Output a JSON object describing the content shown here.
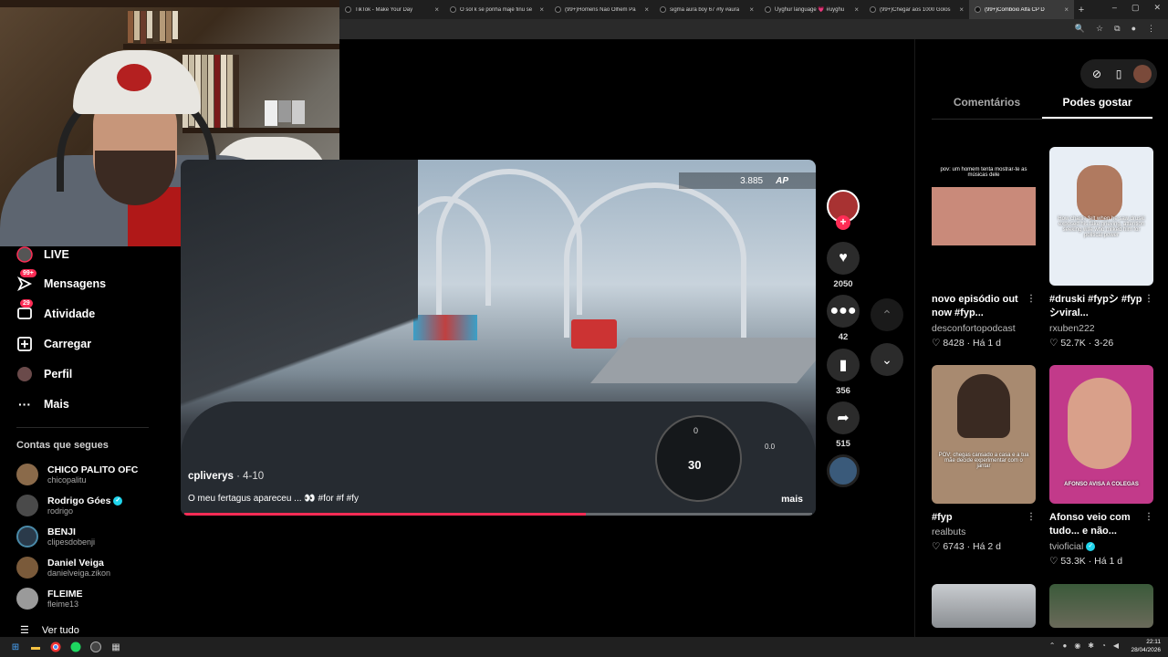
{
  "browser": {
    "tabs": [
      {
        "title": "TikTok - Make Your Day",
        "active": false
      },
      {
        "title": "O sol k se ponha majé finu se",
        "active": false
      },
      {
        "title": "(99+)Homens Não Olhem Pa",
        "active": false
      },
      {
        "title": "sigma aura boy 67 #fy #aura",
        "active": false
      },
      {
        "title": "Uyghur language 💗 #uyghu",
        "active": false
      },
      {
        "title": "(99+)Chegar aos 1000 Golos",
        "active": false
      },
      {
        "title": "(99+)Comboio Alfa CP D",
        "active": true
      }
    ],
    "new_tab": "+",
    "window_controls": [
      "–",
      "▢",
      "✕"
    ]
  },
  "sidebar": {
    "items": [
      {
        "label": "LIVE",
        "icon": "live-icon",
        "badge": ""
      },
      {
        "label": "Mensagens",
        "icon": "messages-icon",
        "badge": "99+"
      },
      {
        "label": "Atividade",
        "icon": "activity-icon",
        "badge": "29"
      },
      {
        "label": "Carregar",
        "icon": "upload-icon",
        "badge": ""
      },
      {
        "label": "Perfil",
        "icon": "profile-icon",
        "badge": ""
      },
      {
        "label": "Mais",
        "icon": "more-icon",
        "badge": ""
      }
    ],
    "following_title": "Contas que segues",
    "following": [
      {
        "name": "CHICO PALITO OFC",
        "handle": "chicopalitu",
        "verified": false
      },
      {
        "name": "Rodrigo Góes",
        "handle": "rodrigo",
        "verified": true
      },
      {
        "name": "BENJI",
        "handle": "clipesdobenji",
        "verified": false
      },
      {
        "name": "Daniel Veiga",
        "handle": "danielveiga.zikon",
        "verified": false
      },
      {
        "name": "FLEIME",
        "handle": "fleime13",
        "verified": false
      }
    ],
    "see_all": "Ver tudo"
  },
  "video": {
    "author": "cpliverys",
    "date": "· 4-10",
    "caption": "O meu fertagus apareceu ... 👀 #for #f #fy",
    "more": "mais",
    "hud_distance": "3.885",
    "hud_logo": "AP",
    "speed": "30",
    "gauge_top": "0",
    "percent": "0.0",
    "progress": 0.64
  },
  "actions": {
    "likes": "2050",
    "comments": "42",
    "saves": "356",
    "shares": "515"
  },
  "right_panel": {
    "tabs": [
      {
        "label": "Comentários",
        "active": false
      },
      {
        "label": "Podes gostar",
        "active": true
      }
    ],
    "cards": [
      {
        "title": "novo episódio out now #fyp...",
        "author": "desconfortopodcast",
        "likes": "8428",
        "age": "Há 1 d",
        "verified": false,
        "overlay": "pov: um homem tenta mostrar-te as músicas dele",
        "bg": "#1a1a1a"
      },
      {
        "title": "#druski #fypシ #fypシviral...",
        "author": "rxuben222",
        "likes": "52.7K",
        "age": "3-26",
        "verified": false,
        "overlay": "How charlie felt when he saw druski exposed his fake grieving, attention seeking wife who milked him for political power",
        "bg": "#e8eef5"
      },
      {
        "title": "#fyp",
        "author": "realbuts",
        "likes": "6743",
        "age": "Há 2 d",
        "verified": false,
        "overlay": "POV: chegas cansado a casa e a tua mãe decide experimentar com o jantar",
        "bg": "#a88a70"
      },
      {
        "title": "Afonso veio com tudo... e não...",
        "author": "tvioficial",
        "likes": "53.3K",
        "age": "Há 1 d",
        "verified": true,
        "overlay": "AFONSO AVISA A COLEGAS",
        "bg": "#c23a8a"
      }
    ]
  },
  "taskbar": {
    "time": "22:11",
    "date": "28/04/2026"
  }
}
